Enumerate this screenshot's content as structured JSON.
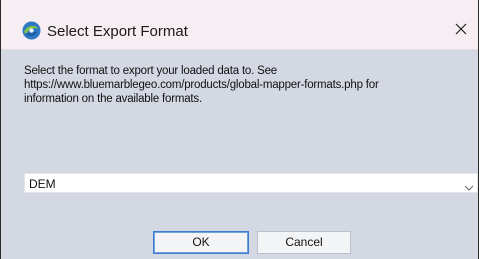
{
  "window": {
    "title": "Select Export Format",
    "app_icon": "globe-swirl-icon",
    "close_icon": "close-icon",
    "accent_color": "#3b7bd0",
    "titlebar_color": "#f6eef2",
    "body_color": "#d4d8e2"
  },
  "description": {
    "line1": "Select the format to export your loaded data to. See",
    "line2": "https://www.bluemarblegeo.com/products/global-mapper-formats.php for",
    "line3": "information on the available formats."
  },
  "format_select": {
    "selected": "DEM",
    "icon": "chevron-down-icon"
  },
  "buttons": {
    "ok_label": "OK",
    "cancel_label": "Cancel"
  }
}
